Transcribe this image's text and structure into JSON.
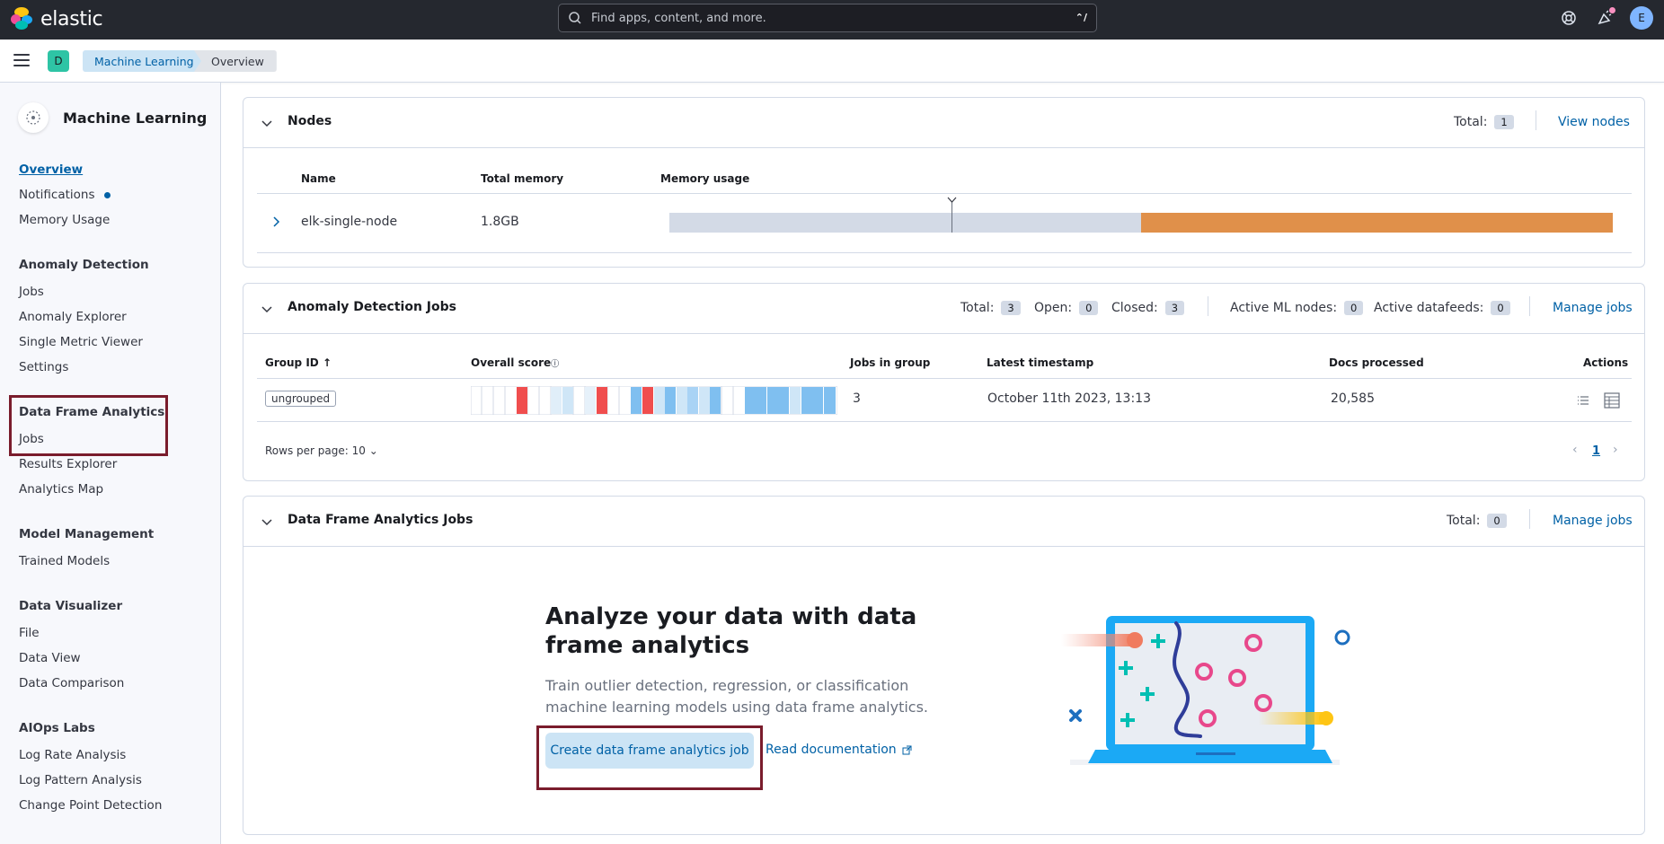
{
  "header": {
    "brand": "elastic",
    "search_placeholder": "Find apps, content, and more.",
    "search_shortcut": "⌃/",
    "user_initial": "E"
  },
  "subbar": {
    "space_initial": "D",
    "breadcrumbs": [
      "Machine Learning",
      "Overview"
    ]
  },
  "sidebar": {
    "title": "Machine Learning",
    "items_top": [
      "Overview",
      "Notifications",
      "Memory Usage"
    ],
    "groups": [
      {
        "label": "Anomaly Detection",
        "items": [
          "Jobs",
          "Anomaly Explorer",
          "Single Metric Viewer",
          "Settings"
        ]
      },
      {
        "label": "Data Frame Analytics",
        "items": [
          "Jobs",
          "Results Explorer",
          "Analytics Map"
        ]
      },
      {
        "label": "Model Management",
        "items": [
          "Trained Models"
        ]
      },
      {
        "label": "Data Visualizer",
        "items": [
          "File",
          "Data View",
          "Data Comparison"
        ]
      },
      {
        "label": "AIOps Labs",
        "items": [
          "Log Rate Analysis",
          "Log Pattern Analysis",
          "Change Point Detection"
        ]
      }
    ]
  },
  "nodes": {
    "title": "Nodes",
    "total_label": "Total:",
    "total": "1",
    "view_link": "View nodes",
    "columns": [
      "Name",
      "Total memory",
      "Memory usage"
    ],
    "row": {
      "name": "elk-single-node",
      "memory": "1.8GB"
    },
    "memory_usage_fraction": 0.5
  },
  "ad_jobs": {
    "title": "Anomaly Detection Jobs",
    "stats": [
      {
        "label": "Total:",
        "value": "3"
      },
      {
        "label": "Open:",
        "value": "0"
      },
      {
        "label": "Closed:",
        "value": "3"
      },
      {
        "label": "Active ML nodes:",
        "value": "0"
      },
      {
        "label": "Active datafeeds:",
        "value": "0"
      }
    ],
    "manage_link": "Manage jobs",
    "columns": [
      "Group ID",
      "Overall score",
      "Jobs in group",
      "Latest timestamp",
      "Docs processed",
      "Actions"
    ],
    "row": {
      "group": "ungrouped",
      "jobs": "3",
      "timestamp": "October 11th 2023, 13:13",
      "docs": "20,585"
    },
    "rows_per_page": "Rows per page: 10",
    "page": "1"
  },
  "dfa_jobs": {
    "title": "Data Frame Analytics Jobs",
    "total_label": "Total:",
    "total": "0",
    "manage_link": "Manage jobs",
    "empty_title": "Analyze your data with data frame analytics",
    "empty_desc": "Train outlier detection, regression, or classification machine learning models using data frame analytics.",
    "create_button": "Create data frame analytics job",
    "doc_link": "Read documentation"
  },
  "colors": {
    "accent": "#0061a6",
    "highlight": "#7a1c2c",
    "critical": "#f04e4e",
    "low": "#a9d3f5",
    "memory": "#e0904a"
  }
}
